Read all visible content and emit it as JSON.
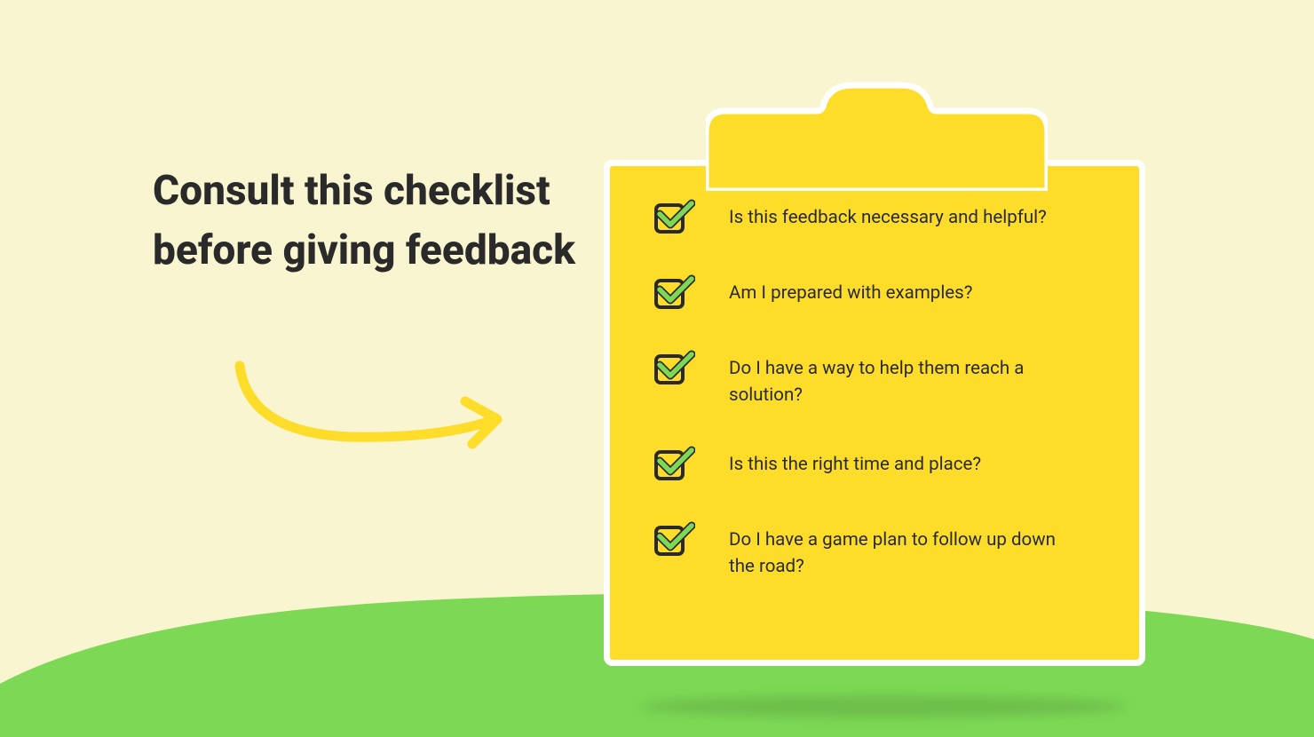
{
  "heading": "Consult this checklist before giving feedback",
  "checklist": {
    "items": [
      {
        "text": "Is this feedback necessary and helpful?"
      },
      {
        "text": "Am I prepared with examples?"
      },
      {
        "text": "Do I have a way to help them reach a solution?"
      },
      {
        "text": "Is this the right time and place?"
      },
      {
        "text": "Do I have a game plan to follow up down the road?"
      }
    ]
  },
  "colors": {
    "background": "#f9f5d0",
    "clipboard": "#fddc2a",
    "clipboardBorder": "#ffffff",
    "hill": "#7dd955",
    "checkmark": "#7dd955",
    "arrow": "#fddc2a",
    "text": "#2a2a2a"
  }
}
